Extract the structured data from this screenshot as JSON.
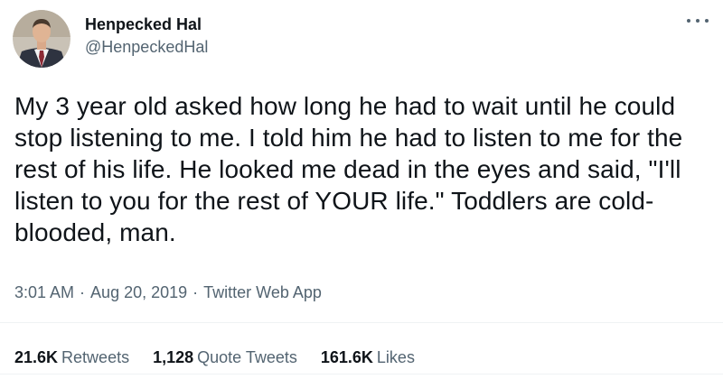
{
  "author": {
    "display_name": "Henpecked Hal",
    "handle": "@HenpeckedHal"
  },
  "tweet": {
    "text": "My 3 year old asked how long he had to wait until he could stop listening to me. I told him he had to listen to me for the rest of his life. He looked me dead in the eyes and said, \"I'll listen to you for the rest of YOUR life.\" Toddlers are cold-blooded, man."
  },
  "meta": {
    "time": "3:01 AM",
    "date": "Aug 20, 2019",
    "source": "Twitter Web App",
    "separator": "·"
  },
  "stats": {
    "retweets_count": "21.6K",
    "retweets_label": "Retweets",
    "quotes_count": "1,128",
    "quotes_label": "Quote Tweets",
    "likes_count": "161.6K",
    "likes_label": "Likes"
  },
  "icons": {
    "more": "more-icon"
  },
  "colors": {
    "text_primary": "#0f1419",
    "text_secondary": "#536471",
    "divider": "#eff3f4"
  }
}
